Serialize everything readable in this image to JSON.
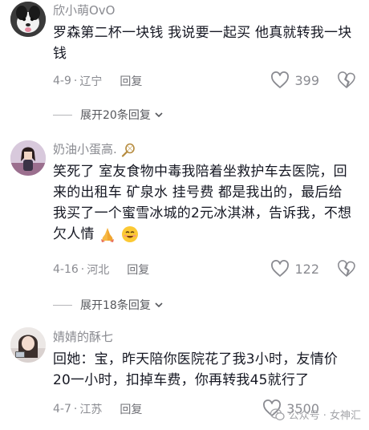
{
  "comments": [
    {
      "username": "欣小萌OvO",
      "text": "罗森第二杯一块钱 我说要一起买 他真就转我一块钱",
      "date": "4-9",
      "location": "辽宁",
      "reply_label": "回复",
      "likes": "399",
      "expand_label": "展开20条回复"
    },
    {
      "username": "奶油小蛋高.",
      "text": "笑死了 室友食物中毒我陪着坐救护车去医院，回来的出租车 矿泉水 挂号费 都是我出的，最后给我买了一个蜜雪冰城的2元冰淇淋，告诉我，不想欠人情",
      "date": "4-16",
      "location": "河北",
      "reply_label": "回复",
      "likes": "122",
      "expand_label": "展开18条回复"
    },
    {
      "username": "婧婧的酥七",
      "text": "回她：宝，昨天陪你医院花了我3小时，友情价20一小时，扣掉车费，你再转我45就行了",
      "date": "4-7",
      "location": "江苏",
      "reply_label": "回复",
      "likes": "3500"
    }
  ],
  "watermark": "公众号 · 女神汇",
  "icons": {
    "like": "heart-outline-icon",
    "dislike": "broken-heart-icon",
    "expand": "chevron-down-icon",
    "username_badge": "tennis-racket-icon",
    "praying_hands": "praying-hands-emoji",
    "smiling_face": "smiling-face-emoji",
    "watermark": "wechat-icon"
  },
  "colors": {
    "text": "#161823",
    "meta": "#8a8b91",
    "background": "#ffffff"
  }
}
